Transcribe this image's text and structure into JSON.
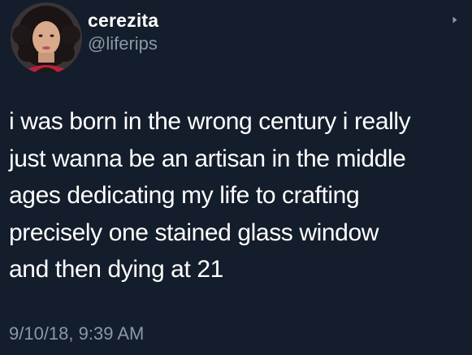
{
  "tweet": {
    "display_name": "cerezita",
    "handle": "@liferips",
    "text": "i was born in the wrong century i really\njust wanna be an artisan in the middle\nages dedicating my life to crafting\nprecisely one stained glass window\nand then dying at 21",
    "timestamp": "9/10/18, 9:39 AM"
  },
  "colors": {
    "background": "#141d2b",
    "primary_text": "#ffffff",
    "secondary_text": "#8899a6"
  },
  "icons": {
    "avatar": "profile-photo",
    "menu": "chevron-down-icon"
  }
}
